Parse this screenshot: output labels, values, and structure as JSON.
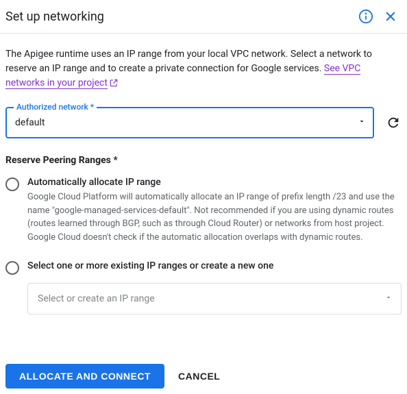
{
  "header": {
    "title": "Set up networking"
  },
  "intro": {
    "text": "The Apigee runtime uses an IP range from your local VPC network. Select a network to reserve an IP range and to create a private connection for Google services. ",
    "link_text": "See VPC networks in your project"
  },
  "network_field": {
    "label": "Authorized network *",
    "value": "default"
  },
  "peering": {
    "section_label": "Reserve Peering Ranges *",
    "auto": {
      "title": "Automatically allocate IP range",
      "desc": "Google Cloud Platform will automatically allocate an IP range of prefix length /23 and use the name \"google-managed-services-default\". Not recommended if you are using dynamic routes (routes learned through BGP, such as through Cloud Router) or networks from host project. Google Cloud doesn't check if the automatic allocation overlaps with dynamic routes."
    },
    "existing": {
      "title": "Select one or more existing IP ranges or create a new one",
      "placeholder": "Select or create an IP range"
    }
  },
  "footer": {
    "primary": "ALLOCATE AND CONNECT",
    "cancel": "CANCEL"
  }
}
